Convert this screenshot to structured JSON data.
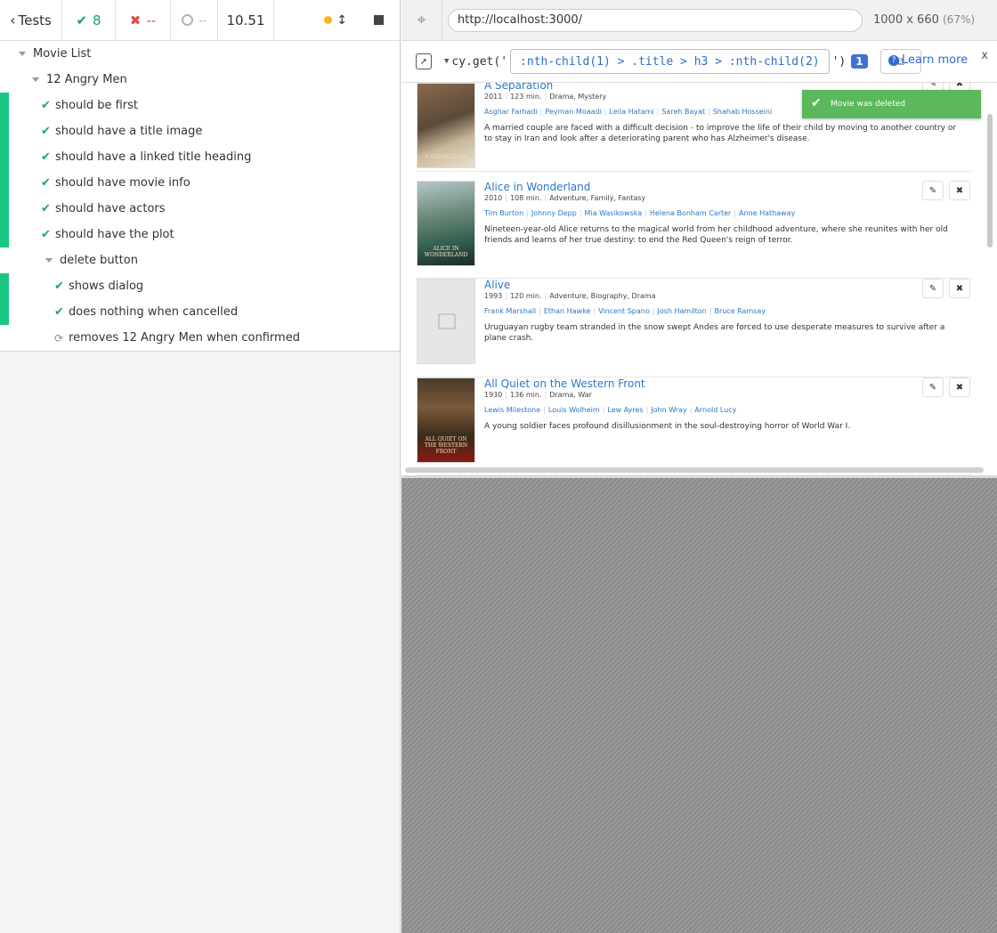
{
  "reporter": {
    "tests_label": "Tests",
    "passed": "8",
    "failed": "--",
    "pending": "--",
    "duration": "10.51",
    "suite": {
      "title": "Movie List",
      "group": "12 Angry Men",
      "tests": [
        "should be first",
        "should have a title image",
        "should have a linked title heading",
        "should have movie info",
        "should have actors",
        "should have the plot"
      ],
      "nested": {
        "title": "delete button",
        "tests": [
          "shows dialog",
          "does nothing when cancelled"
        ],
        "running": "removes 12 Angry Men when confirmed"
      }
    }
  },
  "runner": {
    "url": "http://localhost:3000/",
    "viewport": "1000 x 660",
    "zoom": "(67%)",
    "playground": {
      "method_open": "cy.get('",
      "selector": ":nth-child(1) > .title > h3 > :nth-child(2)",
      "method_close": "')",
      "count": "1",
      "learn_more": "Learn more",
      "close": "x"
    },
    "toast": "Movie was deleted",
    "movies": [
      {
        "title": "A Separation",
        "year": "2011",
        "runtime": "123 min.",
        "genres": "Drama, Mystery",
        "actors": [
          "Asghar Farhadi",
          "Peyman Moaadi",
          "Leila Hatami",
          "Sareh Bayat",
          "Shahab Hosseini"
        ],
        "plot": "A married couple are faced with a difficult decision - to improve the life of their child by moving to another country or to stay in Iran and look after a deteriorating parent who has Alzheimer's disease.",
        "poster_text": "A SEPARATION"
      },
      {
        "title": "Alice in Wonderland",
        "year": "2010",
        "runtime": "108 min.",
        "genres": "Adventure, Family, Fantasy",
        "actors": [
          "Tim Burton",
          "Johnny Depp",
          "Mia Wasikowska",
          "Helena Bonham Carter",
          "Anne Hathaway"
        ],
        "plot": "Nineteen-year-old Alice returns to the magical world from her childhood adventure, where she reunites with her old friends and learns of her true destiny: to end the Red Queen's reign of terror.",
        "poster_text": "ALICE IN WONDERLAND"
      },
      {
        "title": "Alive",
        "year": "1993",
        "runtime": "120 min.",
        "genres": "Adventure, Biography, Drama",
        "actors": [
          "Frank Marshall",
          "Ethan Hawke",
          "Vincent Spano",
          "Josh Hamilton",
          "Bruce Ramsay"
        ],
        "plot": "Uruguayan rugby team stranded in the snow swept Andes are forced to use desperate measures to survive after a plane crash.",
        "poster_text": ""
      },
      {
        "title": "All Quiet on the Western Front",
        "year": "1930",
        "runtime": "136 min.",
        "genres": "Drama, War",
        "actors": [
          "Lewis Milestone",
          "Louis Wolheim",
          "Lew Ayres",
          "John Wray",
          "Arnold Lucy"
        ],
        "plot": "A young soldier faces profound disillusionment in the soul-destroying horror of World War I.",
        "poster_text": "ALL QUIET ON THE WESTERN FRONT"
      }
    ]
  },
  "colors": {
    "pass": "#1aa37a",
    "fail": "#e0493d",
    "link": "#2b77c9",
    "toast": "#5cb85c",
    "selector": "#2b6ccf"
  }
}
